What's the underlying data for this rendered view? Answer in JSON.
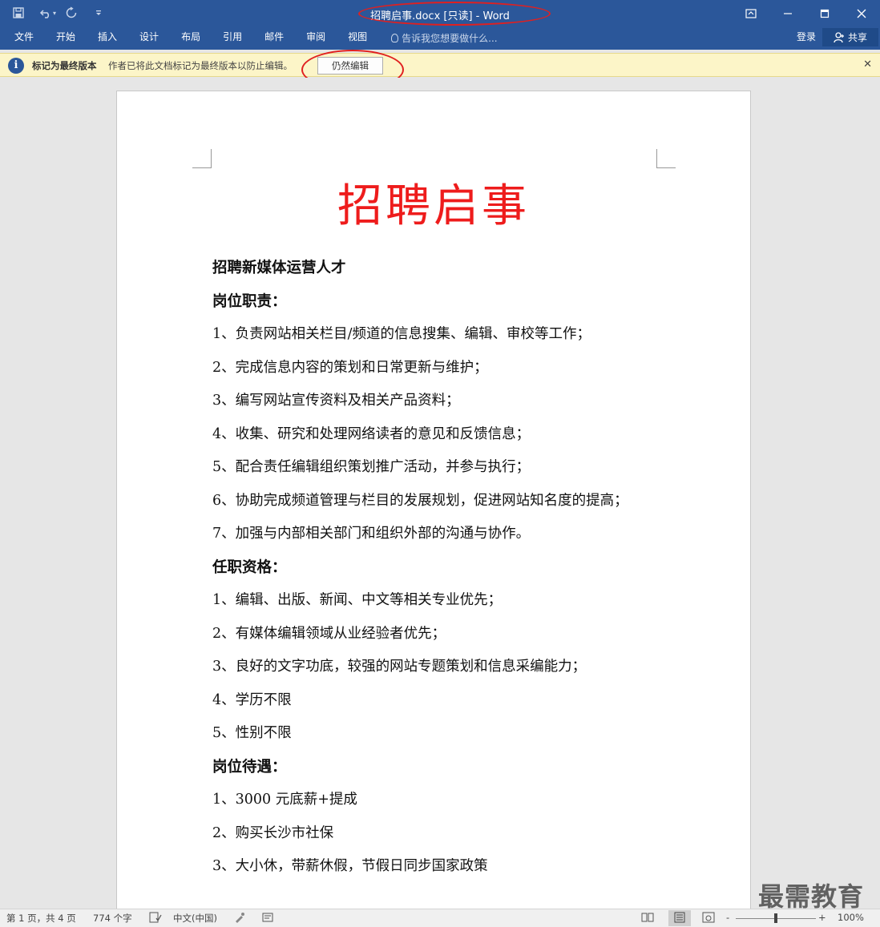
{
  "window": {
    "title": "招聘启事.docx [只读] - Word"
  },
  "qat": {
    "save_icon": "save-icon",
    "undo_icon": "undo-icon",
    "redo_icon": "redo-icon",
    "customize_icon": "customize-icon"
  },
  "ribbon": {
    "tabs": [
      "文件",
      "开始",
      "插入",
      "设计",
      "布局",
      "引用",
      "邮件",
      "审阅",
      "视图"
    ],
    "tell_me": "告诉我您想要做什么...",
    "sign_in": "登录",
    "share": "共享"
  },
  "message_bar": {
    "title": "标记为最终版本",
    "text": "作者已将此文档标记为最终版本以防止编辑。",
    "edit_button": "仍然编辑"
  },
  "document": {
    "title": "招聘启事",
    "lines": [
      {
        "type": "h",
        "text": "招聘新媒体运营人才"
      },
      {
        "type": "h",
        "text": "岗位职责："
      },
      {
        "type": "p",
        "text": "1、负责网站相关栏目/频道的信息搜集、编辑、审校等工作；"
      },
      {
        "type": "p",
        "text": "2、完成信息内容的策划和日常更新与维护；"
      },
      {
        "type": "p",
        "text": "3、编写网站宣传资料及相关产品资料；"
      },
      {
        "type": "p",
        "text": "4、收集、研究和处理网络读者的意见和反馈信息；"
      },
      {
        "type": "p",
        "text": "5、配合责任编辑组织策划推广活动，并参与执行；"
      },
      {
        "type": "p",
        "text": "6、协助完成频道管理与栏目的发展规划，促进网站知名度的提高；"
      },
      {
        "type": "p",
        "text": "7、加强与内部相关部门和组织外部的沟通与协作。"
      },
      {
        "type": "h",
        "text": "任职资格："
      },
      {
        "type": "p",
        "text": "1、编辑、出版、新闻、中文等相关专业优先；"
      },
      {
        "type": "p",
        "text": "2、有媒体编辑领域从业经验者优先；"
      },
      {
        "type": "p",
        "text": "3、良好的文字功底，较强的网站专题策划和信息采编能力；"
      },
      {
        "type": "p",
        "text": "4、学历不限"
      },
      {
        "type": "p",
        "text": "5、性别不限"
      },
      {
        "type": "h",
        "text": "岗位待遇："
      },
      {
        "type": "p",
        "text": "1、3000 元底薪+提成"
      },
      {
        "type": "p",
        "text": "2、购买长沙市社保"
      },
      {
        "type": "p",
        "text": "3、大小休，带薪休假，节假日同步国家政策"
      }
    ]
  },
  "status": {
    "page": "第 1 页，共 4 页",
    "words": "774 个字",
    "language": "中文(中国)",
    "zoom": "100%",
    "zoom_minus": "-",
    "zoom_plus": "+"
  },
  "watermark": "最需教育",
  "colors": {
    "ribbon": "#2b579a",
    "title_red": "#ee1c1c",
    "message_bar": "#fcf5c8",
    "highlight_oval": "#e02020"
  }
}
